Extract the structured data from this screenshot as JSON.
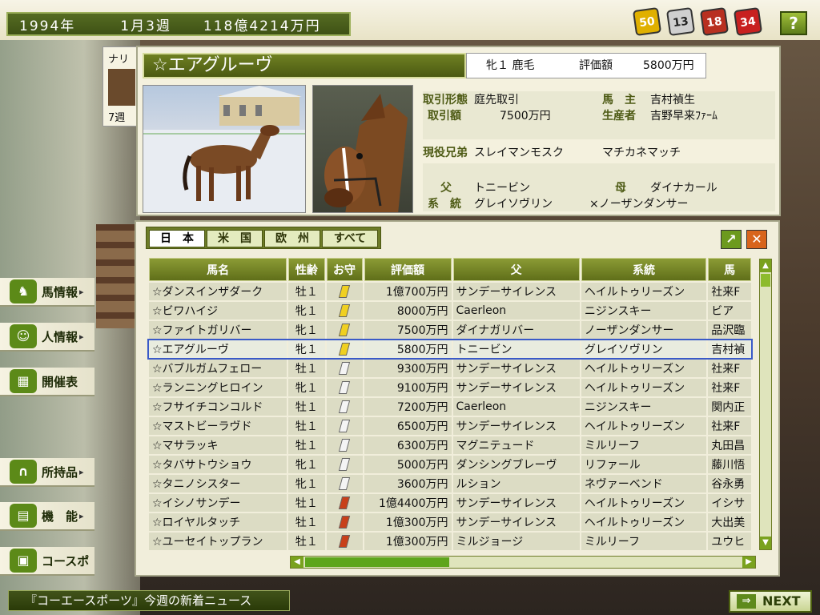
{
  "topbar": {
    "year": "1994年",
    "week": "1月3週",
    "money": "118億4214万円",
    "badges": [
      {
        "value": "50",
        "color": "#e0b000"
      },
      {
        "value": "13",
        "color": "#cfcfcf"
      },
      {
        "value": "18",
        "color": "#b83020"
      },
      {
        "value": "34",
        "color": "#c82020"
      }
    ],
    "help_label": "?"
  },
  "mini_card": {
    "title": "ナリ",
    "week": "7週"
  },
  "horse": {
    "name": "☆エアグルーヴ",
    "sex_age_coat": "牝１ 鹿毛",
    "eval_label": "評価額",
    "eval_value": "5800万円",
    "deal_type_label": "取引形態",
    "deal_type": "庭先取引",
    "deal_amount_label": "取引額",
    "deal_amount": "7500万円",
    "owner_label": "馬　主",
    "owner": "吉村禎生",
    "breeder_label": "生産者",
    "breeder": "吉野早来ﾌｧｰﾑ",
    "siblings_label": "現役兄弟",
    "sibling1": "スレイマンモスク",
    "sibling2": "マチカネマッチ",
    "sire_label": "父",
    "sire": "トニービン",
    "dam_label": "母",
    "dam": "ダイナカール",
    "line_label": "系　統",
    "line": "グレイソヴリン",
    "dam_line": "×ノーザンダンサー"
  },
  "tabs": [
    "日　本",
    "米　国",
    "欧　州",
    "すべて"
  ],
  "active_tab": 0,
  "table": {
    "headers": [
      "馬名",
      "性齢",
      "お守",
      "評価額",
      "父",
      "系統",
      "馬"
    ],
    "rows": [
      {
        "name": "☆ダンスインザダーク",
        "sex": "牡１",
        "amulet": "yellow",
        "eval": "1億700万円",
        "sire": "サンデーサイレンス",
        "line": "ヘイルトゥリーズン",
        "owner": "社来F"
      },
      {
        "name": "☆ビワハイジ",
        "sex": "牝１",
        "amulet": "yellow",
        "eval": "8000万円",
        "sire": "Caerleon",
        "line": "ニジンスキー",
        "owner": "ビア"
      },
      {
        "name": "☆ファイトガリバー",
        "sex": "牝１",
        "amulet": "yellow",
        "eval": "7500万円",
        "sire": "ダイナガリバー",
        "line": "ノーザンダンサー",
        "owner": "品沢臨"
      },
      {
        "name": "☆エアグルーヴ",
        "sex": "牝１",
        "amulet": "yellow",
        "eval": "5800万円",
        "sire": "トニービン",
        "line": "グレイソヴリン",
        "owner": "吉村禎",
        "selected": true
      },
      {
        "name": "☆バブルガムフェロー",
        "sex": "牡１",
        "amulet": "white",
        "eval": "9300万円",
        "sire": "サンデーサイレンス",
        "line": "ヘイルトゥリーズン",
        "owner": "社来F"
      },
      {
        "name": "☆ランニングヒロイン",
        "sex": "牝１",
        "amulet": "white",
        "eval": "9100万円",
        "sire": "サンデーサイレンス",
        "line": "ヘイルトゥリーズン",
        "owner": "社来F"
      },
      {
        "name": "☆フサイチコンコルド",
        "sex": "牡１",
        "amulet": "white",
        "eval": "7200万円",
        "sire": "Caerleon",
        "line": "ニジンスキー",
        "owner": "関内正"
      },
      {
        "name": "☆マストビーラヴド",
        "sex": "牡１",
        "amulet": "white",
        "eval": "6500万円",
        "sire": "サンデーサイレンス",
        "line": "ヘイルトゥリーズン",
        "owner": "社来F"
      },
      {
        "name": "☆マサラッキ",
        "sex": "牡１",
        "amulet": "white",
        "eval": "6300万円",
        "sire": "マグニテュード",
        "line": "ミルリーフ",
        "owner": "丸田昌"
      },
      {
        "name": "☆タバサトウショウ",
        "sex": "牝１",
        "amulet": "white",
        "eval": "5000万円",
        "sire": "ダンシングブレーヴ",
        "line": "リファール",
        "owner": "藤川悟"
      },
      {
        "name": "☆タニノシスター",
        "sex": "牝１",
        "amulet": "white",
        "eval": "3600万円",
        "sire": "ルション",
        "line": "ネヴァーベンド",
        "owner": "谷永勇"
      },
      {
        "name": "☆イシノサンデー",
        "sex": "牡１",
        "amulet": "red",
        "eval": "1億4400万円",
        "sire": "サンデーサイレンス",
        "line": "ヘイルトゥリーズン",
        "owner": "イシサ"
      },
      {
        "name": "☆ロイヤルタッチ",
        "sex": "牡１",
        "amulet": "red",
        "eval": "1億300万円",
        "sire": "サンデーサイレンス",
        "line": "ヘイルトゥリーズン",
        "owner": "大出美"
      },
      {
        "name": "☆ユーセイトップラン",
        "sex": "牡１",
        "amulet": "red",
        "eval": "1億300万円",
        "sire": "ミルジョージ",
        "line": "ミルリーフ",
        "owner": "ユウヒ"
      }
    ]
  },
  "amulet_colors": {
    "yellow": "#f0d020",
    "white": "#f4f4f4",
    "red": "#c8401a"
  },
  "menu": [
    {
      "label": "馬情報",
      "icon": "horse-head-icon",
      "glyph": "♞",
      "chev": true
    },
    {
      "label": "人情報",
      "icon": "person-icon",
      "glyph": "☺",
      "chev": true
    },
    {
      "label": "開催表",
      "icon": "calendar-icon",
      "glyph": "▦",
      "chev": false
    },
    {
      "label": "所持品",
      "icon": "horseshoe-icon",
      "glyph": "∩",
      "chev": true
    },
    {
      "label": "機　能",
      "icon": "folder-icon",
      "glyph": "▤",
      "chev": true
    },
    {
      "label": "コースポ",
      "icon": "monitor-icon",
      "glyph": "▣",
      "chev": false
    }
  ],
  "news": "『コーエースポーツ』今週の新着ニュース",
  "next_label": "NEXT",
  "next_glyph": "⇒"
}
